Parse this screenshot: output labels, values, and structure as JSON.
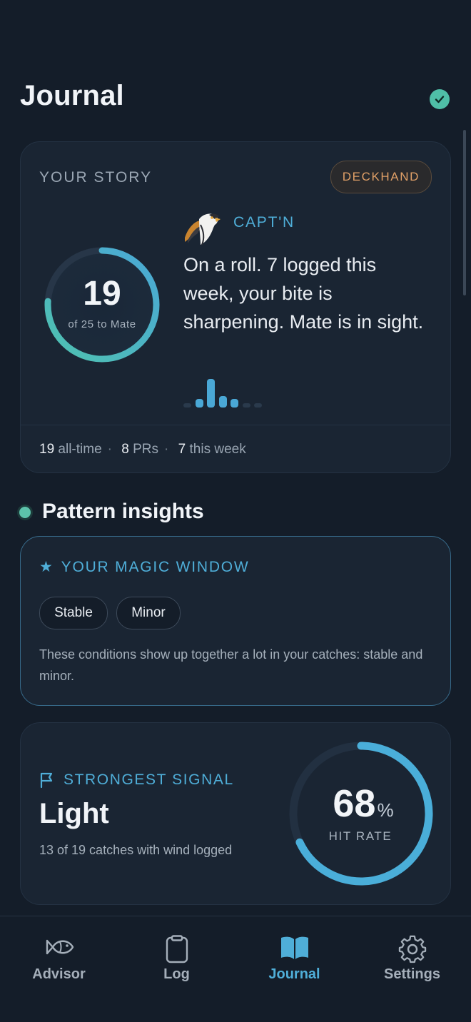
{
  "header": {
    "title": "Journal",
    "status_icon": "check-circle-icon"
  },
  "story": {
    "label": "YOUR STORY",
    "rank_badge": "DECKHAND",
    "progress": {
      "current": "19",
      "caption": "of 25 to Mate",
      "value": 19,
      "target": 25
    },
    "captain": {
      "name": "CAPT'N",
      "avatar_icon": "osprey-avatar-icon",
      "message": "On a roll. 7 logged this week, your bite is sharpening. Mate is in sight."
    },
    "activity_bars": [
      1,
      3,
      10,
      4,
      3,
      1,
      1
    ],
    "stats": [
      {
        "value": "19",
        "label": "all-time"
      },
      {
        "value": "8",
        "label": "PRs"
      },
      {
        "value": "7",
        "label": "this week"
      }
    ]
  },
  "insights": {
    "title": "Pattern insights",
    "magic_window": {
      "title": "YOUR MAGIC WINDOW",
      "star": "★",
      "chips": [
        "Stable",
        "Minor"
      ],
      "description": "These conditions show up together a lot in your catches: stable and minor."
    },
    "strongest_signal": {
      "label": "STRONGEST SIGNAL",
      "value": "Light",
      "detail": "13 of 19 catches with wind logged",
      "rate": "68",
      "rate_unit": "%",
      "rate_label": "HIT RATE",
      "rate_fraction": 0.68
    }
  },
  "tabs": [
    {
      "label": "Advisor",
      "icon": "fish-icon",
      "active": false
    },
    {
      "label": "Log",
      "icon": "clipboard-icon",
      "active": false
    },
    {
      "label": "Journal",
      "icon": "book-icon",
      "active": true
    },
    {
      "label": "Settings",
      "icon": "gear-icon",
      "active": false
    }
  ],
  "colors": {
    "accent": "#4faed8",
    "teal": "#5cc2aa",
    "badge": "#e0a067",
    "background": "#141d29",
    "card": "#1a2533"
  }
}
